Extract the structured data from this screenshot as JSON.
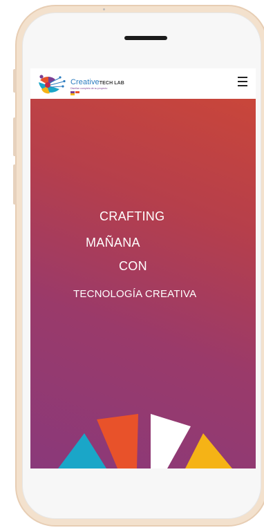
{
  "header": {
    "logo": {
      "word_main": "Creative",
      "word_suffix": "TECH LAB",
      "tagline": "Diseñan completo de su proyecto"
    },
    "menu_icon": "hamburger-icon"
  },
  "hero": {
    "line1": "CRAFTING",
    "line2": "MAÑANA",
    "line3": "CON",
    "line4": "TECNOLOGÍA CREATIVA"
  },
  "colors": {
    "frame": "#f3e1cd",
    "hero_top": "#c9463a",
    "hero_bottom": "#8a397a",
    "segment_blue": "#1aa6c8",
    "segment_orange": "#e8522a",
    "segment_white": "#ffffff",
    "segment_yellow": "#f5b316",
    "brand_blue": "#2a7bbf",
    "brand_purple": "#7a3d92"
  }
}
